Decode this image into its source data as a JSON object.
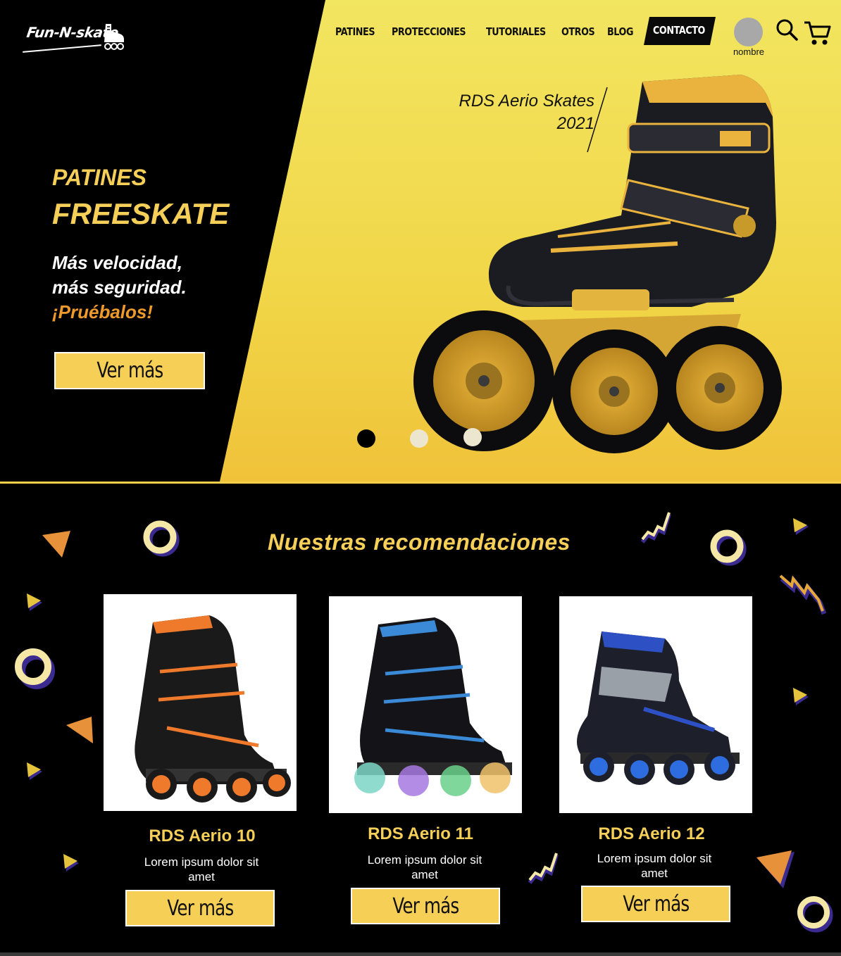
{
  "brand": {
    "logo_text": "Fun-N-skate"
  },
  "nav": {
    "items": [
      "PATINES",
      "PROTECCIONES",
      "TUTORIALES",
      "OTROS",
      "BLOG"
    ],
    "contact": "CONTACTO",
    "user_name": "nombre"
  },
  "hero": {
    "tagline_line1": "RDS Aerio  Skates",
    "tagline_line2": "2021",
    "title_line1": "PATINES",
    "title_line2": "FREESKATE",
    "sub_line1": "Más velocidad,",
    "sub_line2": "más seguridad.",
    "sub_line3": "¡Pruébalos!",
    "button_label": "Ver más",
    "slides_total": 3,
    "slide_active": 1
  },
  "recommendations": {
    "title": "Nuestras recomendaciones",
    "products": [
      {
        "name": "RDS Aerio 10",
        "desc": "Lorem ipsum dolor sit amet",
        "button": "Ver más"
      },
      {
        "name": "RDS Aerio 11",
        "desc": "Lorem ipsum dolor sit amet",
        "button": "Ver más"
      },
      {
        "name": "RDS Aerio 12",
        "desc": "Lorem ipsum dolor sit amet",
        "button": "Ver más"
      }
    ]
  },
  "colors": {
    "accent_yellow": "#f5cf57",
    "accent_orange": "#ee9a2b",
    "deco_purple": "#3b2a8f",
    "background": "#000000"
  }
}
